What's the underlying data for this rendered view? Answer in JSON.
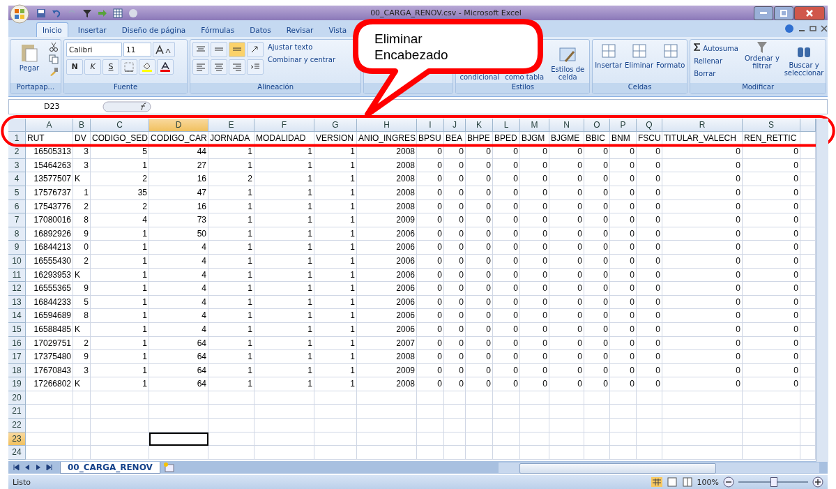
{
  "window": {
    "title": "00_CARGA_RENOV.csv - Microsoft Excel"
  },
  "ribbon_tabs": [
    {
      "label": "Inicio",
      "selected": true
    },
    {
      "label": "Insertar",
      "selected": false
    },
    {
      "label": "Diseño de página",
      "selected": false
    },
    {
      "label": "Fórmulas",
      "selected": false
    },
    {
      "label": "Datos",
      "selected": false
    },
    {
      "label": "Revisar",
      "selected": false
    },
    {
      "label": "Vista",
      "selected": false
    }
  ],
  "ribbon": {
    "clipboard": {
      "paste": "Pegar",
      "group": "Portapap..."
    },
    "font": {
      "name": "Calibri",
      "size": "11",
      "bold": "N",
      "italic": "K",
      "underline": "S",
      "group": "Fuente"
    },
    "alignment": {
      "wrap": "Ajustar texto",
      "merge": "Combinar y centrar",
      "group": "Alineación"
    },
    "styles": {
      "conditional": "condicional",
      "table": "como tabla",
      "cell_styles": "Estilos de celda",
      "group": "Estilos"
    },
    "cells": {
      "buttons": [
        "Insertar",
        "Eliminar",
        "Formato"
      ],
      "group": "Celdas"
    },
    "editing": {
      "autosum": "Autosuma",
      "fill": "Rellenar",
      "clear": "Borrar",
      "sort": "Ordenar y filtrar",
      "find": "Buscar y seleccionar",
      "group": "Modificar"
    }
  },
  "callout": {
    "text": "Eliminar\nEncabezado"
  },
  "formula_bar": {
    "name_box": "D23"
  },
  "sheet": {
    "columns": [
      {
        "letter": "A",
        "selected": false
      },
      {
        "letter": "B",
        "selected": false
      },
      {
        "letter": "C",
        "selected": false
      },
      {
        "letter": "D",
        "selected": true
      },
      {
        "letter": "E",
        "selected": false
      },
      {
        "letter": "F",
        "selected": false
      },
      {
        "letter": "G",
        "selected": false
      },
      {
        "letter": "H",
        "selected": false
      },
      {
        "letter": "I",
        "selected": false
      },
      {
        "letter": "J",
        "selected": false
      },
      {
        "letter": "K",
        "selected": false
      },
      {
        "letter": "L",
        "selected": false
      },
      {
        "letter": "M",
        "selected": false
      },
      {
        "letter": "N",
        "selected": false
      },
      {
        "letter": "O",
        "selected": false
      },
      {
        "letter": "P",
        "selected": false
      },
      {
        "letter": "Q",
        "selected": false
      },
      {
        "letter": "R",
        "selected": false
      },
      {
        "letter": "S",
        "selected": false
      }
    ],
    "rows": [
      {
        "number": "1",
        "selected": false,
        "cells": [
          "RUT",
          "DV",
          "CODIGO_SED",
          "CODIGO_CAR",
          "JORNADA",
          "MODALIDAD",
          "VERSION",
          "ANIO_INGRES",
          "BPSU",
          "BEA",
          "BHPE",
          "BPED",
          "BJGM",
          "BJGME",
          "BBIC",
          "BNM",
          "FSCU",
          "TITULAR_VALECH",
          "REN_RETTIC"
        ]
      },
      {
        "number": "2",
        "selected": false,
        "cells": [
          "16505313",
          "3",
          "5",
          "44",
          "1",
          "1",
          "1",
          "2008",
          "0",
          "0",
          "0",
          "0",
          "0",
          "0",
          "0",
          "0",
          "0",
          "0",
          "0"
        ]
      },
      {
        "number": "3",
        "selected": false,
        "cells": [
          "15464263",
          "3",
          "1",
          "27",
          "1",
          "1",
          "1",
          "2008",
          "0",
          "0",
          "0",
          "0",
          "0",
          "0",
          "0",
          "0",
          "0",
          "0",
          "0"
        ]
      },
      {
        "number": "4",
        "selected": false,
        "cells": [
          "13577507",
          "K",
          "2",
          "16",
          "2",
          "1",
          "1",
          "2008",
          "0",
          "0",
          "0",
          "0",
          "0",
          "0",
          "0",
          "0",
          "0",
          "0",
          "0"
        ]
      },
      {
        "number": "5",
        "selected": false,
        "cells": [
          "17576737",
          "1",
          "35",
          "47",
          "1",
          "1",
          "1",
          "2008",
          "0",
          "0",
          "0",
          "0",
          "0",
          "0",
          "0",
          "0",
          "0",
          "0",
          "0"
        ]
      },
      {
        "number": "6",
        "selected": false,
        "cells": [
          "17543776",
          "2",
          "2",
          "16",
          "1",
          "1",
          "1",
          "2008",
          "0",
          "0",
          "0",
          "0",
          "0",
          "0",
          "0",
          "0",
          "0",
          "0",
          "0"
        ]
      },
      {
        "number": "7",
        "selected": false,
        "cells": [
          "17080016",
          "8",
          "4",
          "73",
          "1",
          "1",
          "1",
          "2009",
          "0",
          "0",
          "0",
          "0",
          "0",
          "0",
          "0",
          "0",
          "0",
          "0",
          "0"
        ]
      },
      {
        "number": "8",
        "selected": false,
        "cells": [
          "16892926",
          "9",
          "1",
          "50",
          "1",
          "1",
          "1",
          "2006",
          "0",
          "0",
          "0",
          "0",
          "0",
          "0",
          "0",
          "0",
          "0",
          "0",
          "0"
        ]
      },
      {
        "number": "9",
        "selected": false,
        "cells": [
          "16844213",
          "0",
          "1",
          "4",
          "1",
          "1",
          "1",
          "2006",
          "0",
          "0",
          "0",
          "0",
          "0",
          "0",
          "0",
          "0",
          "0",
          "0",
          "0"
        ]
      },
      {
        "number": "10",
        "selected": false,
        "cells": [
          "16555430",
          "2",
          "1",
          "4",
          "1",
          "1",
          "1",
          "2006",
          "0",
          "0",
          "0",
          "0",
          "0",
          "0",
          "0",
          "0",
          "0",
          "0",
          "0"
        ]
      },
      {
        "number": "11",
        "selected": false,
        "cells": [
          "16293953",
          "K",
          "1",
          "4",
          "1",
          "1",
          "1",
          "2006",
          "0",
          "0",
          "0",
          "0",
          "0",
          "0",
          "0",
          "0",
          "0",
          "0",
          "0"
        ]
      },
      {
        "number": "12",
        "selected": false,
        "cells": [
          "16555365",
          "9",
          "1",
          "4",
          "1",
          "1",
          "1",
          "2006",
          "0",
          "0",
          "0",
          "0",
          "0",
          "0",
          "0",
          "0",
          "0",
          "0",
          "0"
        ]
      },
      {
        "number": "13",
        "selected": false,
        "cells": [
          "16844233",
          "5",
          "1",
          "4",
          "1",
          "1",
          "1",
          "2006",
          "0",
          "0",
          "0",
          "0",
          "0",
          "0",
          "0",
          "0",
          "0",
          "0",
          "0"
        ]
      },
      {
        "number": "14",
        "selected": false,
        "cells": [
          "16594689",
          "8",
          "1",
          "4",
          "1",
          "1",
          "1",
          "2006",
          "0",
          "0",
          "0",
          "0",
          "0",
          "0",
          "0",
          "0",
          "0",
          "0",
          "0"
        ]
      },
      {
        "number": "15",
        "selected": false,
        "cells": [
          "16588485",
          "K",
          "1",
          "4",
          "1",
          "1",
          "1",
          "2006",
          "0",
          "0",
          "0",
          "0",
          "0",
          "0",
          "0",
          "0",
          "0",
          "0",
          "0"
        ]
      },
      {
        "number": "16",
        "selected": false,
        "cells": [
          "17029751",
          "2",
          "1",
          "64",
          "1",
          "1",
          "1",
          "2007",
          "0",
          "0",
          "0",
          "0",
          "0",
          "0",
          "0",
          "0",
          "0",
          "0",
          "0"
        ]
      },
      {
        "number": "17",
        "selected": false,
        "cells": [
          "17375480",
          "9",
          "1",
          "64",
          "1",
          "1",
          "1",
          "2008",
          "0",
          "0",
          "0",
          "0",
          "0",
          "0",
          "0",
          "0",
          "0",
          "0",
          "0"
        ]
      },
      {
        "number": "18",
        "selected": false,
        "cells": [
          "17670843",
          "3",
          "1",
          "64",
          "1",
          "1",
          "1",
          "2009",
          "0",
          "0",
          "0",
          "0",
          "0",
          "0",
          "0",
          "0",
          "0",
          "0",
          "0"
        ]
      },
      {
        "number": "19",
        "selected": false,
        "cells": [
          "17266802",
          "K",
          "1",
          "64",
          "1",
          "1",
          "1",
          "2008",
          "0",
          "0",
          "0",
          "0",
          "0",
          "0",
          "0",
          "0",
          "0",
          "0",
          "0"
        ]
      },
      {
        "number": "20",
        "selected": false,
        "cells": []
      },
      {
        "number": "21",
        "selected": false,
        "cells": []
      },
      {
        "number": "22",
        "selected": false,
        "cells": []
      },
      {
        "number": "23",
        "selected": true,
        "cells": []
      },
      {
        "number": "24",
        "selected": false,
        "cells": []
      }
    ]
  },
  "sheet_tabs": [
    {
      "label": "00_CARGA_RENOV",
      "selected": true
    }
  ],
  "status_bar": {
    "status": "Listo",
    "zoom": "100%",
    "zoom_slider": {
      "level": 0.5
    }
  }
}
